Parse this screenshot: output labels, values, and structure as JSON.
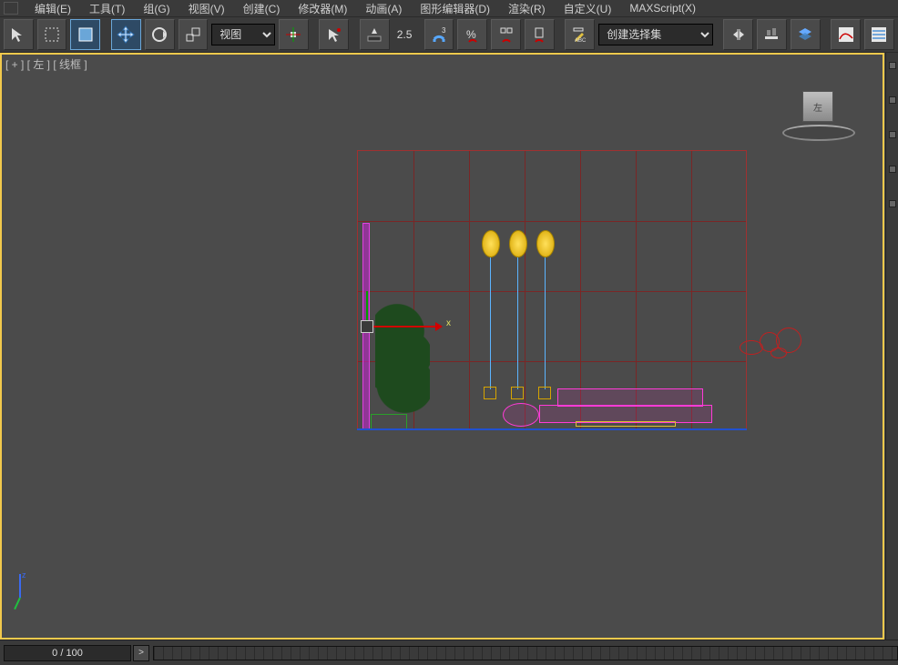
{
  "menu": {
    "items": [
      "编辑(E)",
      "工具(T)",
      "组(G)",
      "视图(V)",
      "创建(C)",
      "修改器(M)",
      "动画(A)",
      "图形编辑器(D)",
      "渲染(R)",
      "自定义(U)",
      "MAXScript(X)"
    ]
  },
  "toolbar": {
    "view_select": "视图",
    "snap_value": "2.5",
    "named_selection": "创建选择集",
    "percent_label": "%"
  },
  "viewport": {
    "label": "[ + ] [ 左 ] [ 线框 ]",
    "viewcube_face": "左",
    "axis_z": "z",
    "gizmo_x": "x"
  },
  "timeline": {
    "frame_display": "0 / 100",
    "step_symbol": ">"
  }
}
